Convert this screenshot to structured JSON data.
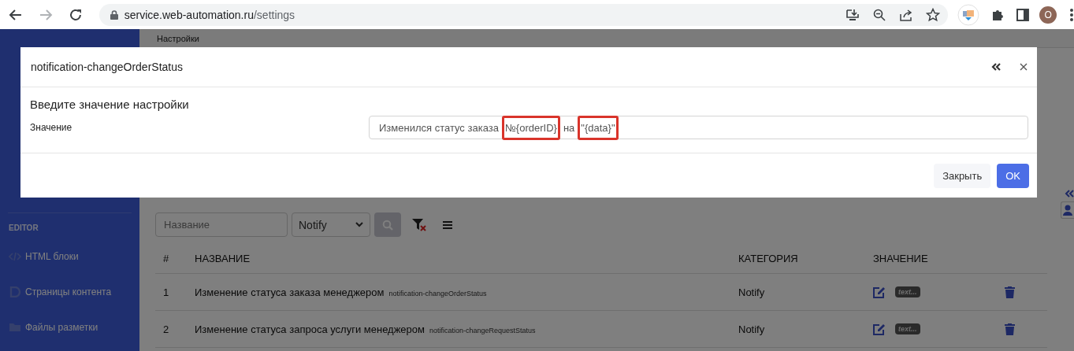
{
  "browser": {
    "url_host": "service.web-automation.ru",
    "url_path": "/settings",
    "back_disabled": false,
    "forward_disabled": true,
    "avatar": "O"
  },
  "breadcrumb": "Настройки",
  "sidebar": {
    "sections": [
      {
        "heading": "EDITOR",
        "items": [
          {
            "label": "HTML блоки",
            "kind": "code"
          },
          {
            "label": "Страницы контента",
            "kind": "page"
          },
          {
            "label": "Файлы разметки",
            "kind": "folder"
          }
        ]
      }
    ]
  },
  "filters": {
    "name_placeholder": "Название",
    "category": "Notify"
  },
  "table": {
    "columns": [
      "#",
      "НАЗВАНИЕ",
      "КАТЕГОРИЯ",
      "ЗНАЧЕНИЕ"
    ],
    "rows": [
      {
        "number": "1",
        "name": "Изменение статуса заказа менеджером",
        "key": "notification-changeOrderStatus",
        "category": "Notify",
        "value_preview": "text..."
      },
      {
        "number": "2",
        "name": "Изменение статуса запроса услуги менеджером",
        "key": "notification-changeRequestStatus",
        "category": "Notify",
        "value_preview": "text..."
      }
    ]
  },
  "modal": {
    "title": "notification-changeOrderStatus",
    "heading": "Введите значение настройки",
    "field_label": "Значение",
    "value_segments": [
      {
        "text": "Изменился статус заказа",
        "highlighted": false
      },
      {
        "text": "№{orderID}",
        "highlighted": true
      },
      {
        "text": "на",
        "highlighted": false
      },
      {
        "text": "\"{data}\"",
        "highlighted": true
      }
    ],
    "buttons": [
      {
        "label": "Закрыть",
        "kind": "secondary"
      },
      {
        "label": "OK",
        "kind": "primary"
      }
    ]
  }
}
